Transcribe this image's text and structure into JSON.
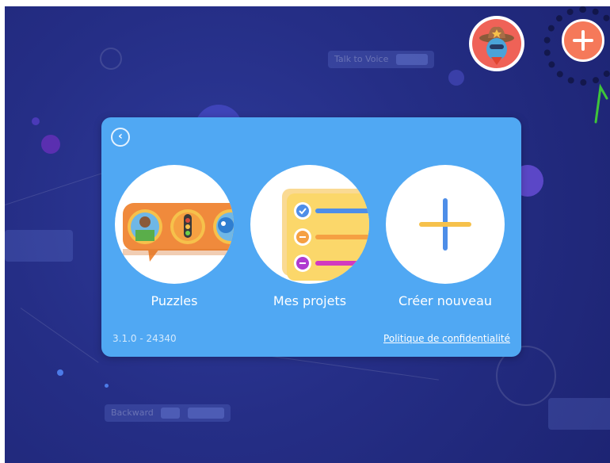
{
  "background": {
    "blocks": [
      {
        "label": "Talk to Voice"
      },
      {
        "label": "Backward"
      }
    ]
  },
  "header": {
    "avatar_icon": "cowboy-avatar-icon",
    "add_icon": "plus-icon"
  },
  "dialog": {
    "back_icon": "chevron-left-icon",
    "tiles": [
      {
        "label": "Puzzles",
        "icon": "puzzles-icon"
      },
      {
        "label": "Mes projets",
        "icon": "projects-list-icon"
      },
      {
        "label": "Créer nouveau",
        "icon": "plus-icon"
      }
    ],
    "version": "3.1.0 - 24340",
    "privacy_link": "Politique de confidentialité"
  },
  "colors": {
    "background": "#252e86",
    "card": "#50a8f3",
    "accent_orange": "#f5795a",
    "avatar_red": "#ef6257",
    "plus_yellow": "#f6c14b",
    "plus_blue": "#4e8ee8"
  }
}
